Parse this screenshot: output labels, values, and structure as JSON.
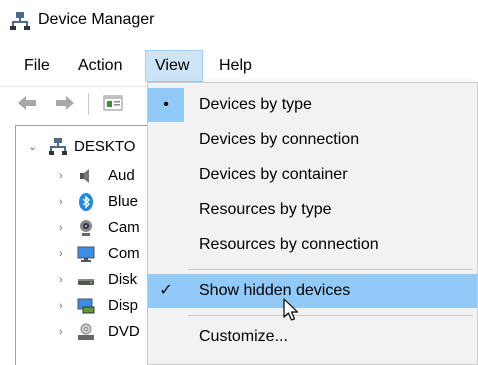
{
  "window": {
    "title": "Device Manager",
    "icon": "device-manager-icon"
  },
  "menubar": {
    "items": [
      {
        "label": "File"
      },
      {
        "label": "Action"
      },
      {
        "label": "View",
        "state": "open"
      },
      {
        "label": "Help"
      }
    ]
  },
  "toolbar": {
    "buttons": [
      "back-arrow-icon",
      "forward-arrow-icon",
      "properties-icon"
    ]
  },
  "tree": {
    "root": {
      "label": "DESKTO",
      "icon": "computer-icon",
      "expanded": true
    },
    "children": [
      {
        "label": "Aud",
        "icon": "speaker-icon"
      },
      {
        "label": "Blue",
        "icon": "bluetooth-icon"
      },
      {
        "label": "Cam",
        "icon": "webcam-icon"
      },
      {
        "label": "Com",
        "icon": "monitor-icon"
      },
      {
        "label": "Disk",
        "icon": "disk-drive-icon"
      },
      {
        "label": "Disp",
        "icon": "display-adapter-icon"
      },
      {
        "label": "DVD",
        "icon": "dvd-drive-icon"
      }
    ]
  },
  "view_menu": {
    "items": [
      {
        "label": "Devices by type",
        "mark": "•",
        "selected": true
      },
      {
        "label": "Devices by connection",
        "mark": ""
      },
      {
        "label": "Devices by container",
        "mark": ""
      },
      {
        "label": "Resources by type",
        "mark": ""
      },
      {
        "label": "Resources by connection",
        "mark": ""
      },
      {
        "label": "Show hidden devices",
        "mark": "✓",
        "checked": true,
        "hovered": true
      },
      {
        "label": "Customize...",
        "mark": ""
      }
    ]
  },
  "colors": {
    "menu_open_bg": "#cce4f7",
    "dropdown_bg": "#f2f2f2",
    "highlight": "#91c9f7"
  }
}
